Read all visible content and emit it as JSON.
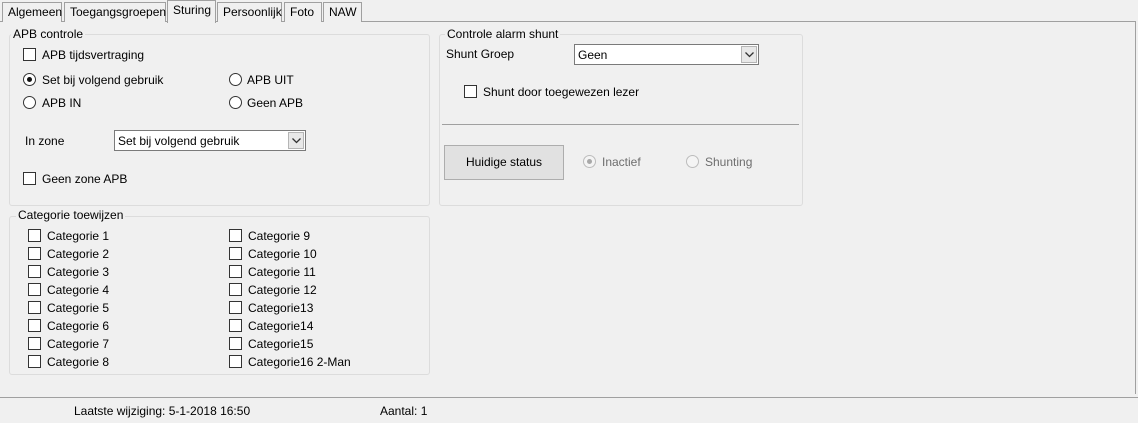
{
  "tabs": [
    "Algemeen",
    "Toegangsgroepen",
    "Sturing",
    "Persoonlijk",
    "Foto",
    "NAW"
  ],
  "apb": {
    "title": "APB controle",
    "delay_label": "APB tijdsvertraging",
    "radio_next_use": "Set bij volgend gebruik",
    "radio_in": "APB IN",
    "radio_out": "APB UIT",
    "radio_none": "Geen APB",
    "zone_label": "In zone",
    "zone_value": "Set bij volgend gebruik",
    "no_zone_label": "Geen zone APB"
  },
  "shunt": {
    "title": "Controle alarm shunt",
    "group_label": "Shunt Groep",
    "group_value": "Geen",
    "reader_label": "Shunt door toegewezen lezer",
    "status_button": "Huidige status",
    "inactive_label": "Inactief",
    "shunting_label": "Shunting"
  },
  "categories": {
    "title": "Categorie toewijzen",
    "items": [
      "Categorie 1",
      "Categorie 2",
      "Categorie 3",
      "Categorie 4",
      "Categorie 5",
      "Categorie 6",
      "Categorie 7",
      "Categorie 8",
      "Categorie 9",
      "Categorie 10",
      "Categorie 11",
      "Categorie 12",
      "Categorie13",
      "Categorie14",
      "Categorie15",
      "Categorie16 2-Man"
    ]
  },
  "status": {
    "last_change": "Laatste wijziging: 5-1-2018 16:50",
    "count": "Aantal: 1"
  }
}
